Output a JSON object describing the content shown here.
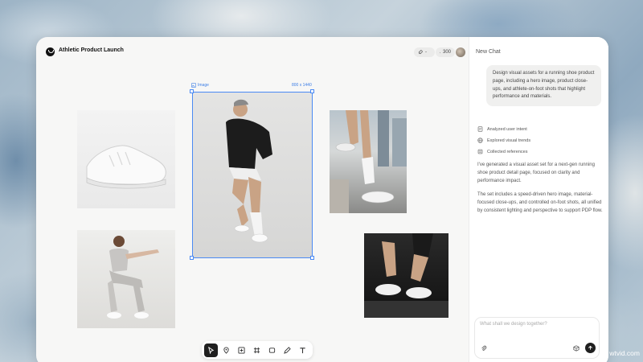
{
  "app": {
    "title": "Athletic Product Launch"
  },
  "header": {
    "model_label": "-",
    "credits": "300"
  },
  "canvas": {
    "selected_label": "Image",
    "selected_size": "800 x 1440",
    "tools": [
      "select",
      "pin",
      "add-image",
      "frame",
      "rectangle",
      "pen",
      "text"
    ]
  },
  "chat": {
    "title": "New Chat",
    "user_message": "Design visual assets for a running shoe product page, including a hero image, product close-ups, and athlete-on-foot shots that highlight performance and materials.",
    "steps": [
      "Analyzed user intent",
      "Explored visual trends",
      "Collected references"
    ],
    "response_1": "I've generated a visual asset set for a next-gen running shoe product detail page, focused on clarity and performance impact.",
    "response_2": "The set includes a speed-driven hero image, material-focused close-ups, and controlled on-foot shots, all unified by consistent lighting and perspective to support PDP flow.",
    "input_placeholder": "What shall we design together?"
  },
  "watermark": "wtvid.com",
  "colors": {
    "accent": "#4a8af4",
    "dark": "#1f1f1f"
  }
}
